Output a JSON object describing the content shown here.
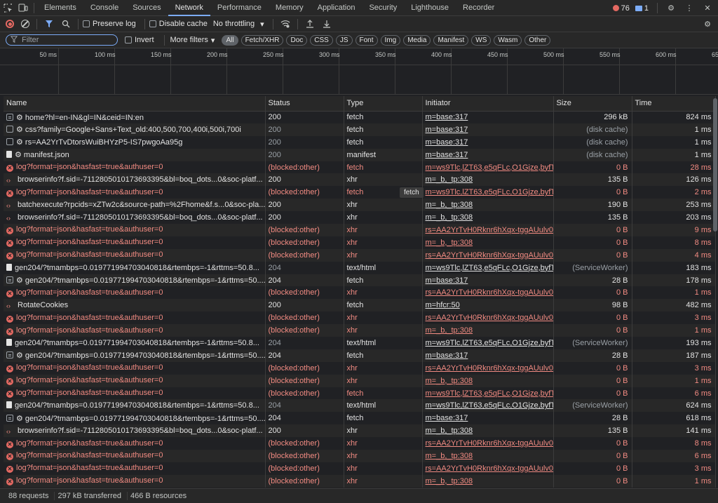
{
  "tabs": [
    "Elements",
    "Console",
    "Sources",
    "Network",
    "Performance",
    "Memory",
    "Application",
    "Security",
    "Lighthouse",
    "Recorder"
  ],
  "active_tab": "Network",
  "badges": {
    "errors": "76",
    "messages": "1"
  },
  "toolbar": {
    "preserve_log": "Preserve log",
    "disable_cache": "Disable cache",
    "throttling": "No throttling"
  },
  "filterbar": {
    "placeholder": "Filter",
    "invert": "Invert",
    "more_filters": "More filters",
    "chips": [
      "All",
      "Fetch/XHR",
      "Doc",
      "CSS",
      "JS",
      "Font",
      "Img",
      "Media",
      "Manifest",
      "WS",
      "Wasm",
      "Other"
    ]
  },
  "timeline_ticks": [
    "50 ms",
    "100 ms",
    "150 ms",
    "200 ms",
    "250 ms",
    "300 ms",
    "350 ms",
    "400 ms",
    "450 ms",
    "500 ms",
    "550 ms",
    "600 ms",
    "650 ms"
  ],
  "columns": {
    "name": "Name",
    "status": "Status",
    "type": "Type",
    "initiator": "Initiator",
    "size": "Size",
    "time": "Time"
  },
  "rows": [
    {
      "icon": "doc",
      "name": "⚙ home?hl=en-IN&gl=IN&ceid=IN:en",
      "status": "200",
      "type": "fetch",
      "initiator": "m=base:317",
      "size": "296 kB",
      "time": "824 ms",
      "err": false
    },
    {
      "icon": "css",
      "name": "⚙ css?family=Google+Sans+Text_old:400,500,700,400i,500i,700i",
      "status": "200",
      "type": "fetch",
      "initiator": "m=base:317",
      "size": "(disk cache)",
      "time": "1 ms",
      "err": false,
      "muted": true
    },
    {
      "icon": "css",
      "name": "⚙ rs=AA2YrTvDtorsWuiBHYzP5-IS7pwgoAa95g",
      "status": "200",
      "type": "fetch",
      "initiator": "m=base:317",
      "size": "(disk cache)",
      "time": "1 ms",
      "err": false,
      "muted": true
    },
    {
      "icon": "page",
      "name": "⚙ manifest.json",
      "status": "200",
      "type": "manifest",
      "initiator": "m=base:317",
      "size": "(disk cache)",
      "time": "1 ms",
      "err": false,
      "muted": true
    },
    {
      "icon": "err",
      "name": "log?format=json&hasfast=true&authuser=0",
      "status": "(blocked:other)",
      "type": "fetch",
      "initiator": "m=ws9Tlc,lZT63,e5qFLc,O1Gjze,byfTO",
      "size": "0 B",
      "time": "28 ms",
      "err": true
    },
    {
      "icon": "xhr",
      "name": "browserinfo?f.sid=-7112805010173693395&bl=boq_dots...0&soc-platf...",
      "status": "200",
      "type": "xhr",
      "initiator": "m=_b,_tp:308",
      "size": "135 B",
      "time": "126 ms",
      "err": false
    },
    {
      "icon": "err",
      "name": "log?format=json&hasfast=true&authuser=0",
      "status": "(blocked:other)",
      "type": "fetch",
      "initiator": "m=ws9Tlc,lZT63,e5qFLc,O1Gjze,byfTO",
      "size": "0 B",
      "time": "2 ms",
      "err": true
    },
    {
      "icon": "xhr",
      "name": "batchexecute?rpcids=xZTw2c&source-path=%2Fhome&f.s...0&soc-pla...",
      "status": "200",
      "type": "xhr",
      "initiator": "m=_b,_tp:308",
      "size": "190 B",
      "time": "253 ms",
      "err": false
    },
    {
      "icon": "xhr",
      "name": "browserinfo?f.sid=-7112805010173693395&bl=boq_dots...0&soc-platf...",
      "status": "200",
      "type": "xhr",
      "initiator": "m=_b,_tp:308",
      "size": "135 B",
      "time": "203 ms",
      "err": false
    },
    {
      "icon": "err",
      "name": "log?format=json&hasfast=true&authuser=0",
      "status": "(blocked:other)",
      "type": "xhr",
      "initiator": "rs=AA2YrTvH0Rknr6hXqx-tggAUulv05",
      "size": "0 B",
      "time": "9 ms",
      "err": true
    },
    {
      "icon": "err",
      "name": "log?format=json&hasfast=true&authuser=0",
      "status": "(blocked:other)",
      "type": "xhr",
      "initiator": "m=_b,_tp:308",
      "size": "0 B",
      "time": "8 ms",
      "err": true
    },
    {
      "icon": "err",
      "name": "log?format=json&hasfast=true&authuser=0",
      "status": "(blocked:other)",
      "type": "xhr",
      "initiator": "rs=AA2YrTvH0Rknr6hXqx-tggAUulv05",
      "size": "0 B",
      "time": "4 ms",
      "err": true
    },
    {
      "icon": "page",
      "name": "gen204/?tmambps=0.019771994703040818&rtembps=-1&rttms=50.8...",
      "status": "204",
      "type": "text/html",
      "initiator": "m=ws9Tlc,lZT63,e5qFLc,O1Gjze,byfTO",
      "size": "(ServiceWorker)",
      "time": "183 ms",
      "err": false,
      "muted": true
    },
    {
      "icon": "doc",
      "name": "⚙ gen204/?tmambps=0.019771994703040818&rtembps=-1&rttms=50....",
      "status": "204",
      "type": "fetch",
      "initiator": "m=base:317",
      "size": "28 B",
      "time": "178 ms",
      "err": false
    },
    {
      "icon": "err",
      "name": "log?format=json&hasfast=true&authuser=0",
      "status": "(blocked:other)",
      "type": "xhr",
      "initiator": "rs=AA2YrTvH0Rknr6hXqx-tggAUulv05",
      "size": "0 B",
      "time": "1 ms",
      "err": true
    },
    {
      "icon": "xhr",
      "name": "RotateCookies",
      "status": "200",
      "type": "fetch",
      "initiator": "m=hfcr:50",
      "size": "98 B",
      "time": "482 ms",
      "err": false
    },
    {
      "icon": "err",
      "name": "log?format=json&hasfast=true&authuser=0",
      "status": "(blocked:other)",
      "type": "xhr",
      "initiator": "rs=AA2YrTvH0Rknr6hXqx-tggAUulv05",
      "size": "0 B",
      "time": "3 ms",
      "err": true
    },
    {
      "icon": "err",
      "name": "log?format=json&hasfast=true&authuser=0",
      "status": "(blocked:other)",
      "type": "xhr",
      "initiator": "m=_b,_tp:308",
      "size": "0 B",
      "time": "1 ms",
      "err": true
    },
    {
      "icon": "page",
      "name": "gen204/?tmambps=0.019771994703040818&rtembps=-1&rttms=50.8...",
      "status": "204",
      "type": "text/html",
      "initiator": "m=ws9Tlc,lZT63,e5qFLc,O1Gjze,byfTO",
      "size": "(ServiceWorker)",
      "time": "193 ms",
      "err": false,
      "muted": true
    },
    {
      "icon": "doc",
      "name": "⚙ gen204/?tmambps=0.019771994703040818&rtembps=-1&rttms=50....",
      "status": "204",
      "type": "fetch",
      "initiator": "m=base:317",
      "size": "28 B",
      "time": "187 ms",
      "err": false
    },
    {
      "icon": "err",
      "name": "log?format=json&hasfast=true&authuser=0",
      "status": "(blocked:other)",
      "type": "xhr",
      "initiator": "rs=AA2YrTvH0Rknr6hXqx-tggAUulv05",
      "size": "0 B",
      "time": "3 ms",
      "err": true
    },
    {
      "icon": "err",
      "name": "log?format=json&hasfast=true&authuser=0",
      "status": "(blocked:other)",
      "type": "xhr",
      "initiator": "m=_b,_tp:308",
      "size": "0 B",
      "time": "1 ms",
      "err": true
    },
    {
      "icon": "err",
      "name": "log?format=json&hasfast=true&authuser=0",
      "status": "(blocked:other)",
      "type": "fetch",
      "initiator": "m=ws9Tlc,lZT63,e5qFLc,O1Gjze,byfTO",
      "size": "0 B",
      "time": "6 ms",
      "err": true
    },
    {
      "icon": "page",
      "name": "gen204/?tmambps=0.019771994703040818&rtembps=-1&rttms=50.8...",
      "status": "204",
      "type": "text/html",
      "initiator": "m=ws9Tlc,lZT63,e5qFLc,O1Gjze,byfTO",
      "size": "(ServiceWorker)",
      "time": "624 ms",
      "err": false,
      "muted": true
    },
    {
      "icon": "doc",
      "name": "⚙ gen204/?tmambps=0.019771994703040818&rtembps=-1&rttms=50....",
      "status": "204",
      "type": "fetch",
      "initiator": "m=base:317",
      "size": "28 B",
      "time": "618 ms",
      "err": false
    },
    {
      "icon": "xhr",
      "name": "browserinfo?f.sid=-7112805010173693395&bl=boq_dots...0&soc-platf...",
      "status": "200",
      "type": "xhr",
      "initiator": "m=_b,_tp:308",
      "size": "135 B",
      "time": "141 ms",
      "err": false
    },
    {
      "icon": "err",
      "name": "log?format=json&hasfast=true&authuser=0",
      "status": "(blocked:other)",
      "type": "xhr",
      "initiator": "rs=AA2YrTvH0Rknr6hXqx-tggAUulv05",
      "size": "0 B",
      "time": "8 ms",
      "err": true
    },
    {
      "icon": "err",
      "name": "log?format=json&hasfast=true&authuser=0",
      "status": "(blocked:other)",
      "type": "xhr",
      "initiator": "m=_b,_tp:308",
      "size": "0 B",
      "time": "6 ms",
      "err": true
    },
    {
      "icon": "err",
      "name": "log?format=json&hasfast=true&authuser=0",
      "status": "(blocked:other)",
      "type": "xhr",
      "initiator": "rs=AA2YrTvH0Rknr6hXqx-tggAUulv05",
      "size": "0 B",
      "time": "3 ms",
      "err": true
    },
    {
      "icon": "err",
      "name": "log?format=json&hasfast=true&authuser=0",
      "status": "(blocked:other)",
      "type": "xhr",
      "initiator": "m=_b,_tp:308",
      "size": "0 B",
      "time": "1 ms",
      "err": true
    }
  ],
  "tooltip": "fetch",
  "status_bar": {
    "requests": "88 requests",
    "transferred": "297 kB transferred",
    "resources": "466 B resources"
  },
  "colors": {
    "accent": "#7cacf8",
    "error": "#f28b82",
    "background": "#202124"
  }
}
